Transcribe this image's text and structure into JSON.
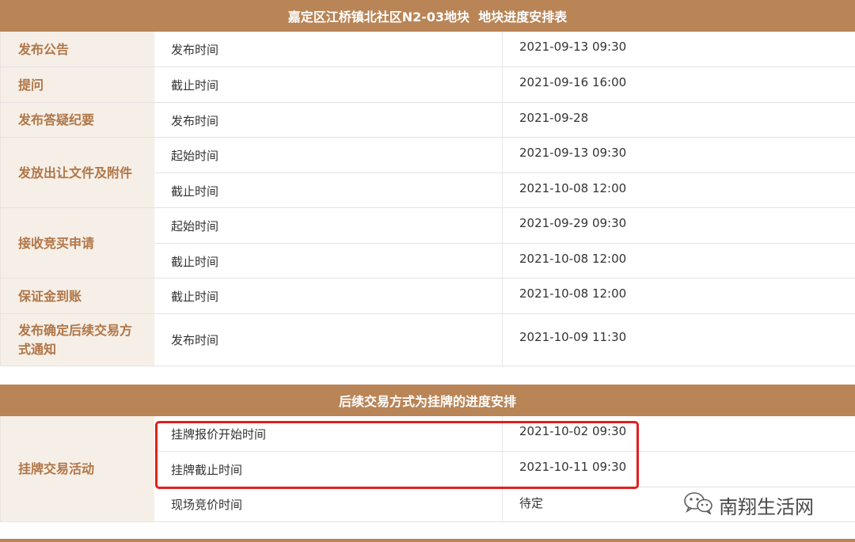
{
  "table1": {
    "title": "嘉定区江桥镇北社区N2-03地块  地块进度安排表",
    "rows": [
      {
        "label": "发布公告",
        "sub": [
          {
            "type": "发布时间",
            "value": "2021-09-13 09:30"
          }
        ]
      },
      {
        "label": "提问",
        "sub": [
          {
            "type": "截止时间",
            "value": "2021-09-16 16:00"
          }
        ]
      },
      {
        "label": "发布答疑纪要",
        "sub": [
          {
            "type": "发布时间",
            "value": "2021-09-28"
          }
        ]
      },
      {
        "label": "发放出让文件及附件",
        "sub": [
          {
            "type": "起始时间",
            "value": "2021-09-13 09:30"
          },
          {
            "type": "截止时间",
            "value": "2021-10-08 12:00"
          }
        ]
      },
      {
        "label": "接收竞买申请",
        "sub": [
          {
            "type": "起始时间",
            "value": "2021-09-29 09:30"
          },
          {
            "type": "截止时间",
            "value": "2021-10-08 12:00"
          }
        ]
      },
      {
        "label": "保证金到账",
        "sub": [
          {
            "type": "截止时间",
            "value": "2021-10-08 12:00"
          }
        ]
      },
      {
        "label": "发布确定后续交易方式通知",
        "sub": [
          {
            "type": "发布时间",
            "value": "2021-10-09 11:30"
          }
        ]
      }
    ]
  },
  "table2": {
    "title": "后续交易方式为挂牌的进度安排",
    "label": "挂牌交易活动",
    "sub": [
      {
        "type": "挂牌报价开始时间",
        "value": "2021-10-02 09:30"
      },
      {
        "type": "挂牌截止时间",
        "value": "2021-10-11 09:30"
      },
      {
        "type": "现场竞价时间",
        "value": "待定"
      }
    ]
  },
  "watermark": {
    "text": "南翔生活网",
    "icon": "wechat-icon"
  },
  "colors": {
    "header": "#b98456",
    "label": "#b07648",
    "label_bg": "#f6efe7",
    "highlight": "#e0201c"
  }
}
